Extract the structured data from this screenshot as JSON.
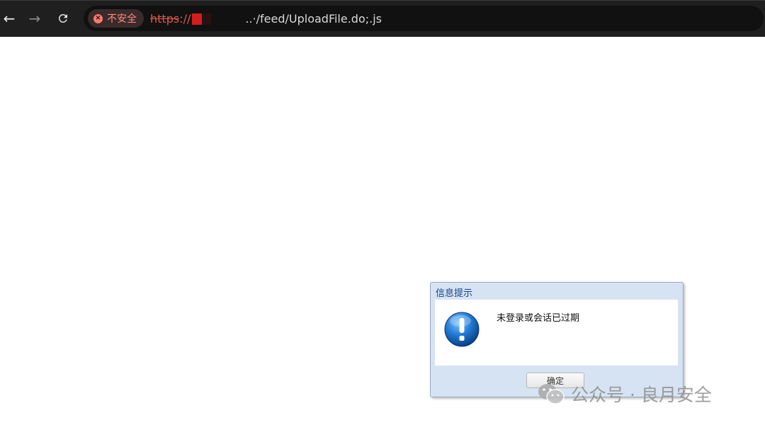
{
  "browser": {
    "security_label": "不安全",
    "url_scheme": "https",
    "url_separator": "://",
    "url_path": "..·/feed/UploadFile.do;.js",
    "nav": {
      "back_icon": "arrow-left-icon",
      "forward_icon": "arrow-right-icon",
      "reload_icon": "reload-icon"
    },
    "colors": {
      "toolbar_bg": "#1f1f1f",
      "omnibox_bg": "#111111",
      "insecure": "#ff8a80",
      "redaction": "#d21e1e"
    }
  },
  "dialog": {
    "title": "信息提示",
    "message": "未登录或会话已过期",
    "icon": "info-exclamation-icon",
    "ok_label": "确定",
    "colors": {
      "frame_bg": "#d6e3f2",
      "title_text": "#15428b"
    }
  },
  "watermark": {
    "text": "公众号 · 良月安全",
    "icon": "wechat-icon"
  }
}
